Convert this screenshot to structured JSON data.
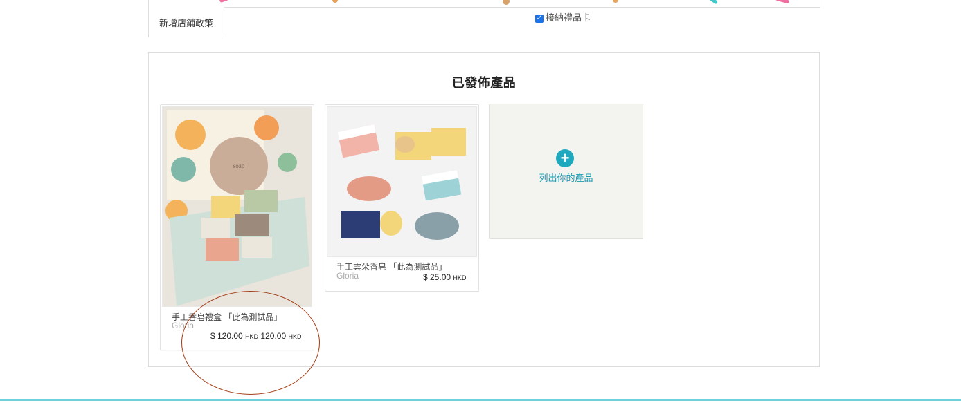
{
  "policy_tab": {
    "label": "新增店鋪政策"
  },
  "gift_card": {
    "label": "接納禮品卡",
    "checked": true
  },
  "published": {
    "title": "已發佈產品",
    "products": [
      {
        "name": "手工香皂禮盒 「此為測試品」",
        "seller": "Gloria",
        "price": "$ 120.00",
        "currency": "HKD",
        "price2": "120.00",
        "currency2": "HKD"
      },
      {
        "name": "手工雲朵香皂 「此為測試品」",
        "seller": "Gloria",
        "price": "$ 25.00",
        "currency": "HKD"
      }
    ],
    "add_product": {
      "label": "列出你的產品",
      "icon": "plus-circle-icon"
    }
  },
  "colors": {
    "accent": "#1fa9bf",
    "annotation": "#a33c16",
    "bottom_bar": "#6fd0d9"
  }
}
